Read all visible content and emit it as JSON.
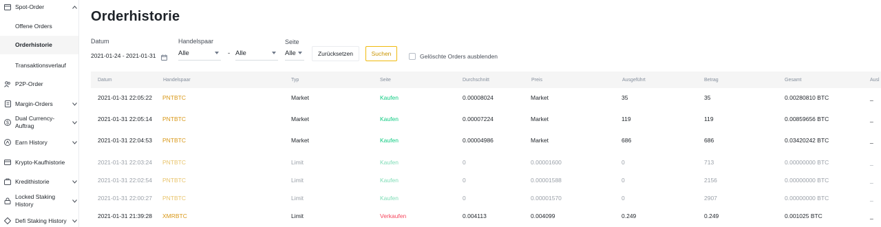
{
  "sidebar": {
    "items": [
      {
        "label": "Spot-Order",
        "icon": "wallet-icon",
        "chevron": "chevron-up-icon"
      },
      {
        "label": "Offene Orders"
      },
      {
        "label": "Orderhistorie"
      },
      {
        "label": "Transaktionsverlauf"
      },
      {
        "label": "P2P-Order",
        "icon": "users-icon"
      },
      {
        "label": "Margin-Orders",
        "icon": "document-icon",
        "chevron": "chevron-down-icon"
      },
      {
        "label": "Dual Currency-Auftrag",
        "icon": "dollar-icon",
        "chevron": "chevron-down-icon"
      },
      {
        "label": "Earn History",
        "icon": "earn-icon",
        "chevron": "chevron-down-icon"
      },
      {
        "label": "Krypto-Kaufhistorie",
        "icon": "card-icon"
      },
      {
        "label": "Kredithistorie",
        "icon": "loan-icon",
        "chevron": "chevron-down-icon"
      },
      {
        "label": "Locked Staking History",
        "icon": "lock-icon",
        "chevron": "chevron-down-icon"
      },
      {
        "label": "Defi Staking History",
        "icon": "defi-icon",
        "chevron": "chevron-down-icon"
      }
    ]
  },
  "page": {
    "title": "Orderhistorie"
  },
  "filters": {
    "date_label": "Datum",
    "date_value": "2021-01-24 - 2021-01-31",
    "pair_label": "Handelspaar",
    "pair_value_1": "Alle",
    "pair_separator": "-",
    "pair_value_2": "Alle",
    "side_label": "Seite",
    "side_value": "Alle",
    "reset_label": "Zurücksetzen",
    "search_label": "Suchen",
    "hide_cancelled_label": "Gelöschte Orders ausblenden",
    "hide_cancelled_checked": false
  },
  "table": {
    "columns": [
      "Datum",
      "Handelspaar",
      "Typ",
      "Seite",
      "Durchschnitt",
      "Preis",
      "Ausgeführt",
      "Betrag",
      "Gesamt",
      "Ausl"
    ],
    "rows": [
      {
        "date": "2021-01-31 22:05:22",
        "pair": "PNTBTC",
        "type": "Market",
        "side": "Kaufen",
        "avg": "0.00008024",
        "price": "Market",
        "executed": "35",
        "amount": "35",
        "total": "0.00280810 BTC",
        "trigger": "_",
        "status": "filled"
      },
      {
        "date": "2021-01-31 22:05:14",
        "pair": "PNTBTC",
        "type": "Market",
        "side": "Kaufen",
        "avg": "0.00007224",
        "price": "Market",
        "executed": "119",
        "amount": "119",
        "total": "0.00859656 BTC",
        "trigger": "_",
        "status": "filled"
      },
      {
        "date": "2021-01-31 22:04:53",
        "pair": "PNTBTC",
        "type": "Market",
        "side": "Kaufen",
        "avg": "0.00004986",
        "price": "Market",
        "executed": "686",
        "amount": "686",
        "total": "0.03420242 BTC",
        "trigger": "_",
        "status": "filled"
      },
      {
        "date": "2021-01-31 22:03:24",
        "pair": "PNTBTC",
        "type": "Limit",
        "side": "Kaufen",
        "avg": "0",
        "price": "0.00001600",
        "executed": "0",
        "amount": "713",
        "total": "0.00000000 BTC",
        "trigger": "_",
        "status": "cancelled"
      },
      {
        "date": "2021-01-31 22:02:54",
        "pair": "PNTBTC",
        "type": "Limit",
        "side": "Kaufen",
        "avg": "0",
        "price": "0.00001588",
        "executed": "0",
        "amount": "2156",
        "total": "0.00000000 BTC",
        "trigger": "_",
        "status": "cancelled"
      },
      {
        "date": "2021-01-31 22:00:27",
        "pair": "PNTBTC",
        "type": "Limit",
        "side": "Kaufen",
        "avg": "0",
        "price": "0.00001570",
        "executed": "0",
        "amount": "2907",
        "total": "0.00000000 BTC",
        "trigger": "_",
        "status": "cancelled"
      },
      {
        "date": "2021-01-31 21:39:28",
        "pair": "XMRBTC",
        "type": "Limit",
        "side": "Verkaufen",
        "avg": "0.004113",
        "price": "0.004099",
        "executed": "0.249",
        "amount": "0.249",
        "total": "0.001025 BTC",
        "trigger": "_",
        "status": "filled"
      }
    ]
  },
  "colors": {
    "accent": "#f0b90b",
    "pair": "#d89614",
    "buy": "#0ecb81",
    "sell": "#f6465d",
    "muted": "#9aa0a8"
  }
}
